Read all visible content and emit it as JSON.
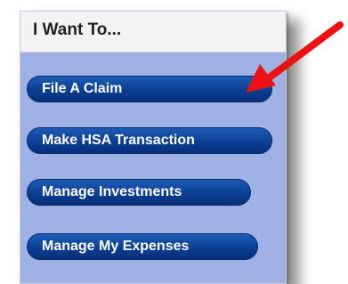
{
  "panel": {
    "title": "I Want To...",
    "buttons": [
      {
        "label": "File A Claim"
      },
      {
        "label": "Make HSA Transaction"
      },
      {
        "label": "Manage Investments"
      },
      {
        "label": "Manage My Expenses"
      }
    ]
  },
  "annotation": {
    "arrow_color": "#ee1111",
    "icon": "red-arrow-icon"
  },
  "colors": {
    "panel_bg": "#9fb0e4",
    "button_bg": "#0b3f93",
    "header_bg": "#f3f3f5"
  }
}
